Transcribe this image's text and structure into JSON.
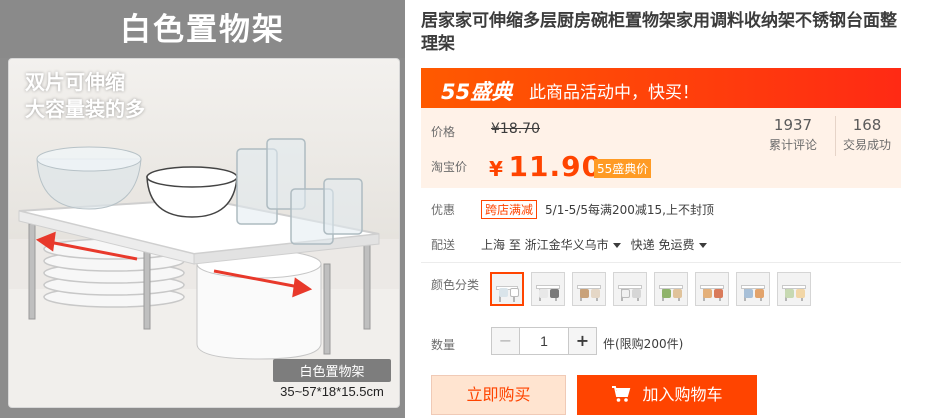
{
  "gallery": {
    "banner": "白色置物架",
    "caption_line1": "双片可伸缩",
    "caption_line2": "大容量装的多",
    "bottom_name": "白色置物架",
    "bottom_size": "35~57*18*15.5cm"
  },
  "product": {
    "title": "居家家可伸缩多层厨房碗柜置物架家用调料收纳架不锈钢台面整理架"
  },
  "promo": {
    "badge": "55盛典",
    "text": "此商品活动中，快买！"
  },
  "price": {
    "original_label": "价格",
    "original_value": "¥18.70",
    "current_label": "淘宝价",
    "currency": "¥",
    "current_value": "11.90",
    "event_tag": "55盛典价"
  },
  "stats": {
    "reviews_count": "1937",
    "reviews_label": "累计评论",
    "sales_count": "168",
    "sales_label": "交易成功"
  },
  "coupon": {
    "label": "优惠",
    "tag": "跨店满减",
    "text": "5/1-5/5每满200减15,上不封顶"
  },
  "shipping": {
    "label": "配送",
    "from": "上海 至",
    "to": "浙江金华义乌市",
    "method": "快递 免运费"
  },
  "variants": {
    "label": "颜色分类",
    "selected_index": 0,
    "count": 8
  },
  "quantity": {
    "label": "数量",
    "value": "1",
    "minus": "−",
    "plus": "+",
    "limit_note": "件(限购200件)"
  },
  "actions": {
    "buy_now": "立即购买",
    "add_to_cart": "加入购物车"
  },
  "colors": {
    "accent": "#ff4400",
    "promo_start": "#ff5a00",
    "price_bg": "#fff2e8"
  }
}
